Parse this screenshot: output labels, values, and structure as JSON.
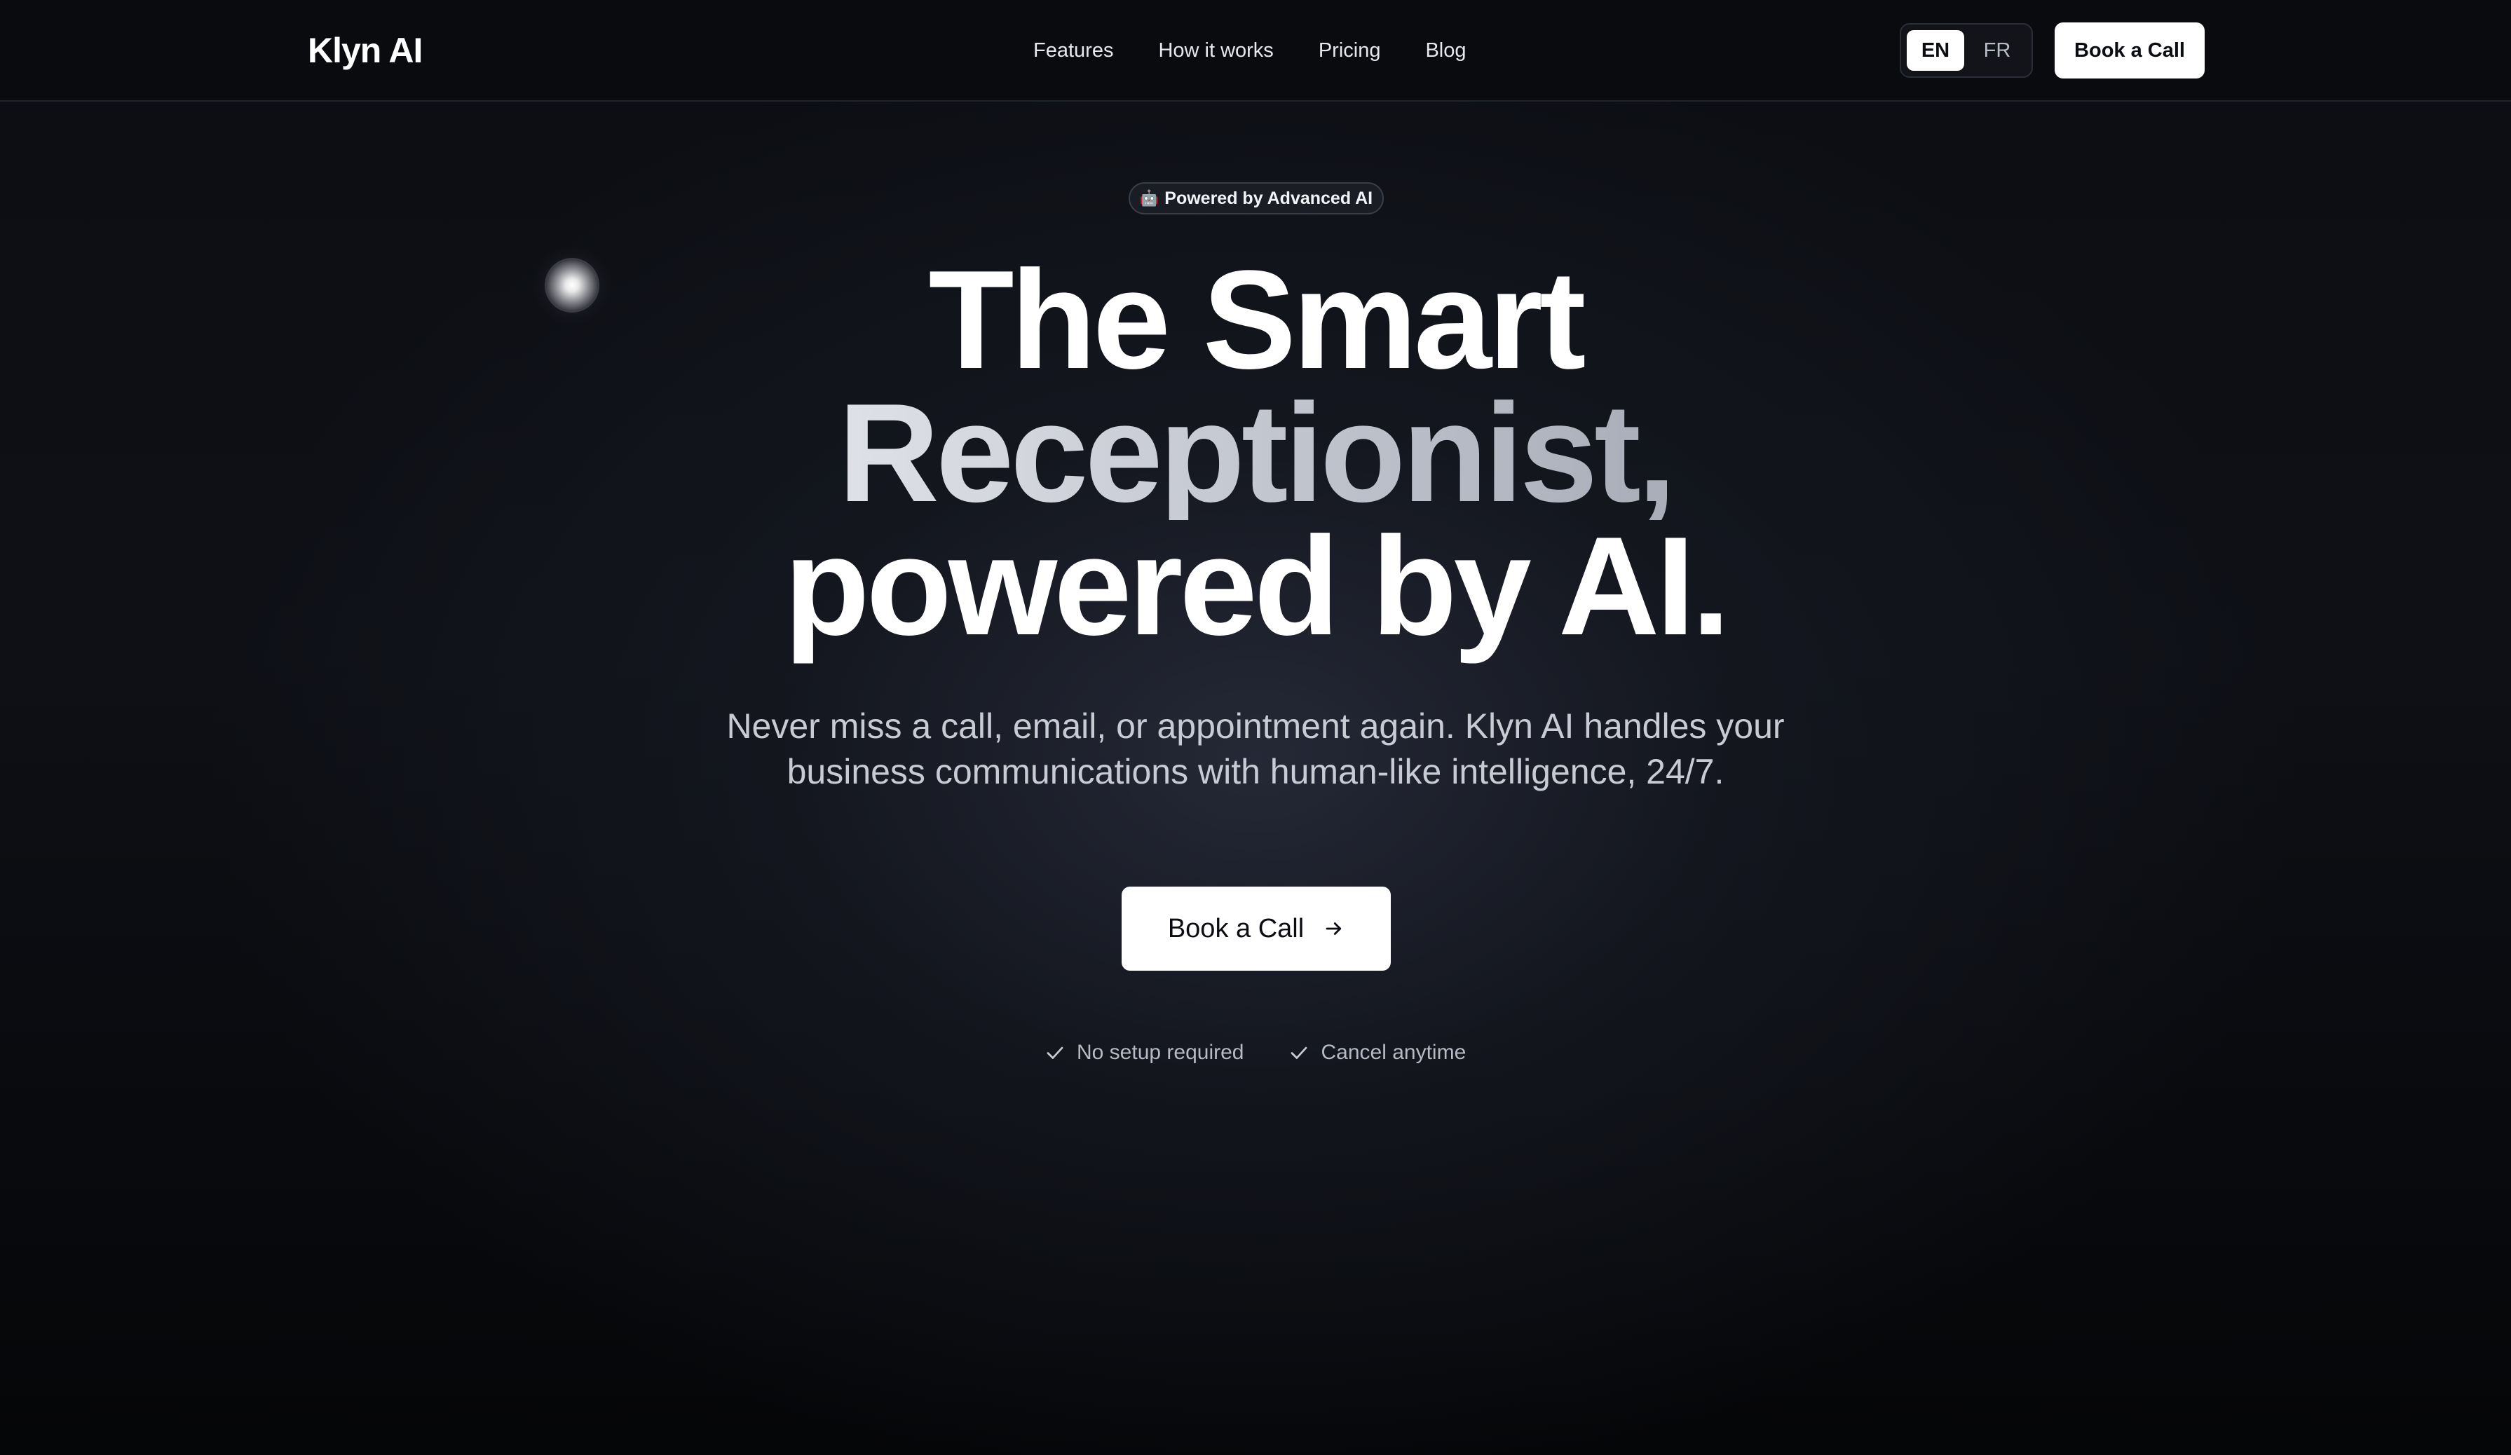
{
  "header": {
    "logo": "Klyn AI",
    "nav": [
      {
        "label": "Features"
      },
      {
        "label": "How it works"
      },
      {
        "label": "Pricing"
      },
      {
        "label": "Blog"
      }
    ],
    "languages": {
      "active": "EN",
      "inactive": "FR"
    },
    "cta_label": "Book a Call"
  },
  "hero": {
    "badge_icon": "robot-icon",
    "badge_label": "Powered by Advanced AI",
    "headline": {
      "line1": "The Smart",
      "line2": "Receptionist,",
      "line3": "powered by AI."
    },
    "subtitle": "Never miss a call, email, or appointment again. Klyn AI handles your business communications with human-like intelligence, 24/7.",
    "cta_label": "Book a Call",
    "cta_icon": "arrow-right-icon",
    "checks": [
      {
        "icon": "check-icon",
        "label": "No setup required"
      },
      {
        "icon": "check-icon",
        "label": "Cancel anytime"
      }
    ]
  },
  "colors": {
    "background": "#0b0d12",
    "primary_button": "#ffffff",
    "primary_button_text": "#0b0d12",
    "muted_text": "#c8cbd3"
  }
}
